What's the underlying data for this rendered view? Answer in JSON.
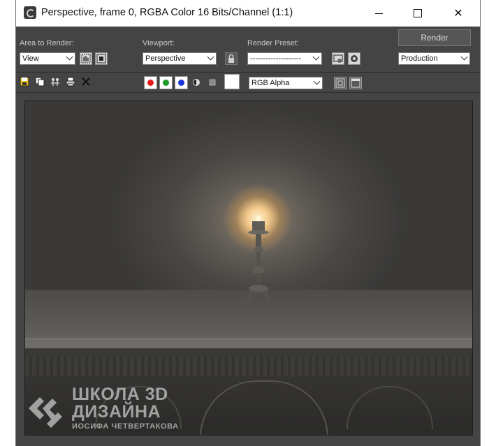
{
  "window": {
    "title": "Perspective, frame 0, RGBA Color 16 Bits/Channel (1:1)",
    "minimize_icon": "minimize-icon",
    "maximize_icon": "maximize-icon",
    "close_icon": "close-icon"
  },
  "toolbar": {
    "area_label": "Area to Render:",
    "area_value": "View",
    "viewport_label": "Viewport:",
    "viewport_value": "Perspective",
    "preset_label": "Render Preset:",
    "preset_value": "--------------------",
    "render_label": "Render",
    "mode_value": "Production",
    "channel_value": "RGB Alpha"
  },
  "channels": {
    "red": "#e31b1b",
    "green": "#1f9a2a",
    "blue": "#1a36d6"
  },
  "watermark": {
    "line1": "ШКОЛА 3D",
    "line2": "ДИЗАЙНА",
    "line3": "ИОСИФА ЧЕТВЕРТАКОВА"
  }
}
